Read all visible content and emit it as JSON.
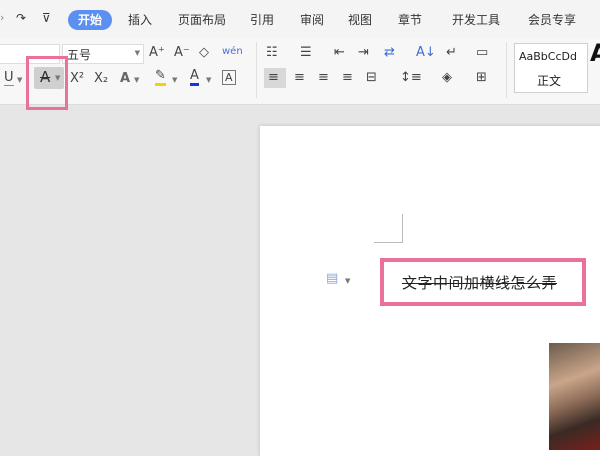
{
  "menu": {
    "redo_icon": "↷",
    "dropdown_icon": "⊽",
    "tabs": [
      "开始",
      "插入",
      "页面布局",
      "引用",
      "审阅",
      "视图",
      "章节",
      "开发工具",
      "会员专享"
    ]
  },
  "ribbon": {
    "font_size": "五号",
    "grow_font": "A⁺",
    "shrink_font": "A⁻",
    "clear_format": "◇",
    "phonetic": "wén",
    "underline": "U",
    "strikethrough": "A",
    "superscript": "X²",
    "subscript": "X₂",
    "text_effect": "A",
    "highlight": "✎",
    "font_color": "A",
    "char_border": "A",
    "styles": {
      "sample": "AaBbCcDd",
      "normal": "正文",
      "next_big": "A"
    }
  },
  "document": {
    "text": "文字中间加横线怎么弄"
  },
  "colors": {
    "accent": "#5b8ff2",
    "highlight_frame": "#e9719a",
    "font_color_bar": "#1a33e0",
    "highlight_bar": "#f2d200"
  }
}
